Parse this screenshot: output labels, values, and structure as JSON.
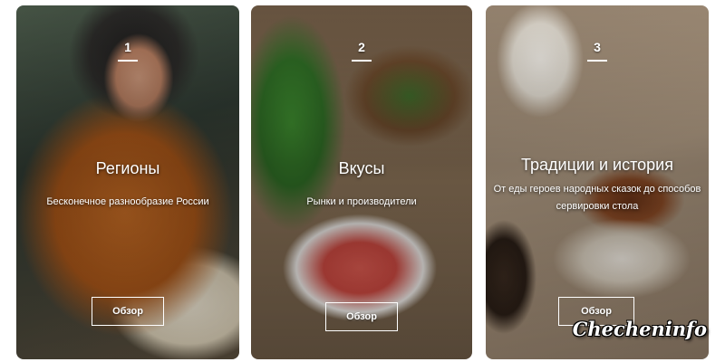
{
  "cards": [
    {
      "number": "1",
      "title": "Регионы",
      "subtitle": "Бесконечное разнообразие России",
      "button_label": "Обзор"
    },
    {
      "number": "2",
      "title": "Вкусы",
      "subtitle": "Рынки и производители",
      "button_label": "Обзор"
    },
    {
      "number": "3",
      "title": "Традиции и история",
      "subtitle": "От еды героев народных сказок до способов сервировки стола",
      "button_label": "Обзор"
    }
  ],
  "watermark": "Checheninfo",
  "colors": {
    "overlay_text": "#ffffff",
    "button_border": "#ffffff"
  }
}
